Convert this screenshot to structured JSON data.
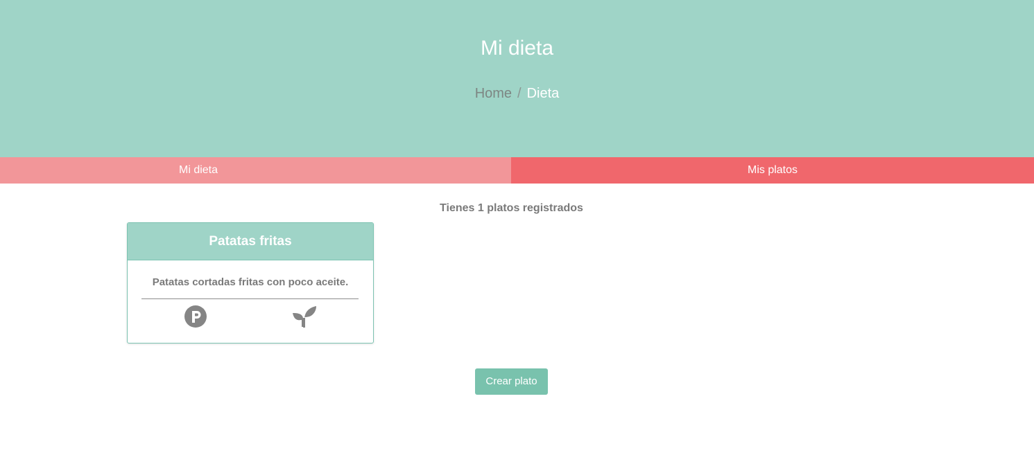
{
  "header": {
    "title": "Mi dieta",
    "breadcrumb": {
      "home": "Home",
      "separator": "/",
      "current": "Dieta"
    }
  },
  "tabs": [
    {
      "label": "Mi dieta"
    },
    {
      "label": "Mis platos"
    }
  ],
  "main": {
    "count_text": "Tienes 1 platos registrados",
    "dishes": [
      {
        "name": "Patatas fritas",
        "description": "Patatas cortadas fritas con poco aceite.",
        "icons": [
          "parking-p-icon",
          "sprout-icon"
        ]
      }
    ],
    "create_button_label": "Crear plato"
  },
  "colors": {
    "header_bg": "#9fd4c7",
    "tab_left_bg": "#f29699",
    "tab_right_bg": "#f0676c",
    "button_bg": "#79c2ad",
    "icon_gray": "#858585"
  }
}
